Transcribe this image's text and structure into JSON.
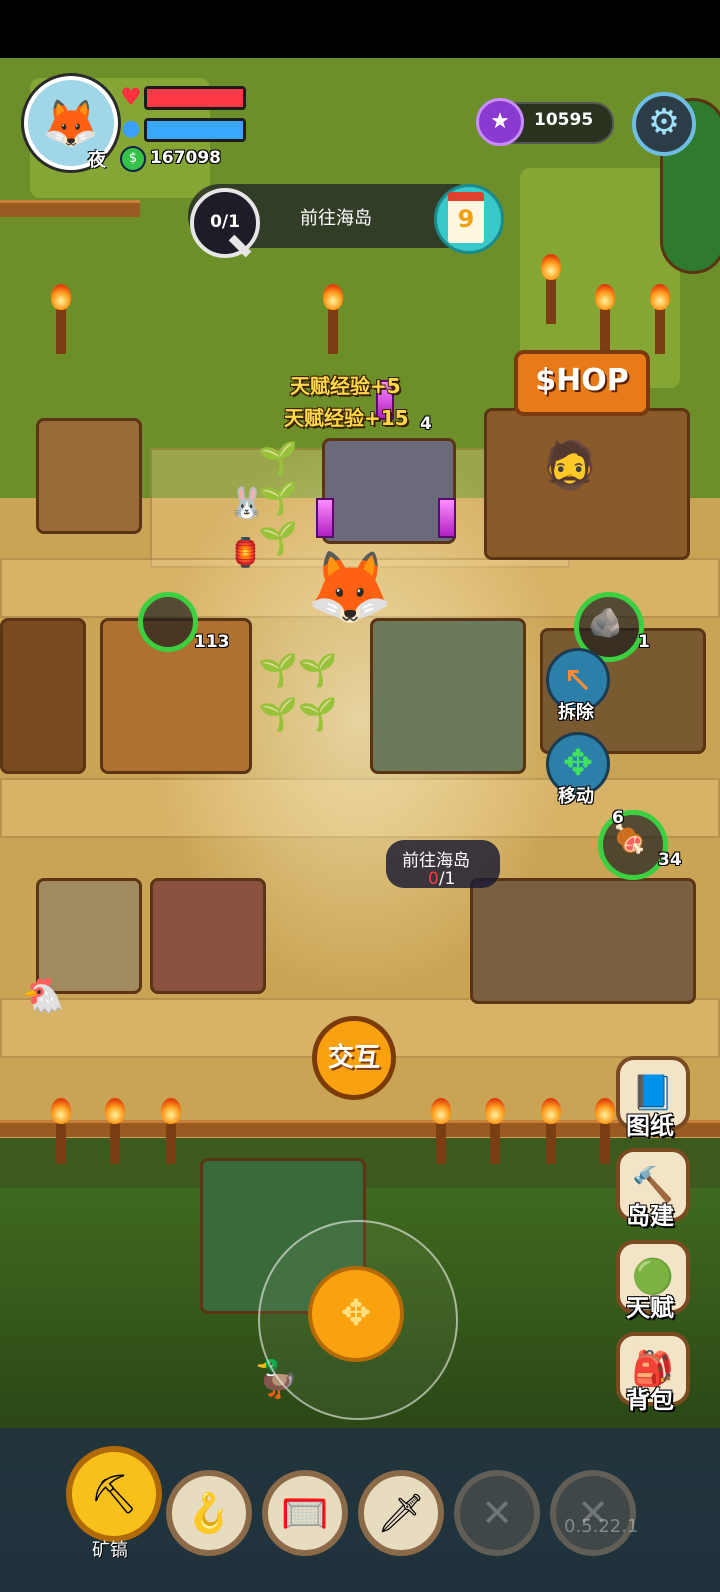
{
  "player": {
    "avatar_icon": "🦊",
    "time_of_day": "夜",
    "health_fraction": 1.0,
    "energy_fraction": 1.0,
    "coins": "167098"
  },
  "currency": {
    "gems": "10595"
  },
  "quest": {
    "progress": "0/1",
    "text": "前往海岛"
  },
  "calendar": {
    "day_icon": "9"
  },
  "world": {
    "exp_popup_1": "天赋经验+5",
    "exp_popup_2": "天赋经验+15",
    "altar_count": "4",
    "shop_sign": "$HOP",
    "furnace_count": "113",
    "stone_count": "1",
    "meat_count": "6",
    "meat_total": "34"
  },
  "destination": {
    "title": "前往海岛",
    "count_current": "0",
    "count_total": "/1"
  },
  "building_actions": {
    "demolish": "拆除",
    "move": "移动"
  },
  "interact_label": "交互",
  "side_menu": [
    {
      "label": "图纸",
      "icon": "📘"
    },
    {
      "label": "岛建",
      "icon": "🔨"
    },
    {
      "label": "天赋",
      "icon": "🟢"
    },
    {
      "label": "背包",
      "icon": "🎒"
    }
  ],
  "hotbar": {
    "selected_label": "矿镐",
    "slots": [
      "⛏",
      "🪝",
      "🥅",
      "🗡",
      "",
      ""
    ]
  },
  "version": "0.5.22.1",
  "colors": {
    "health": "#ff3848",
    "energy": "#3aa7ff",
    "accent": "#f9a10e",
    "gem": "#8a3ad0"
  }
}
